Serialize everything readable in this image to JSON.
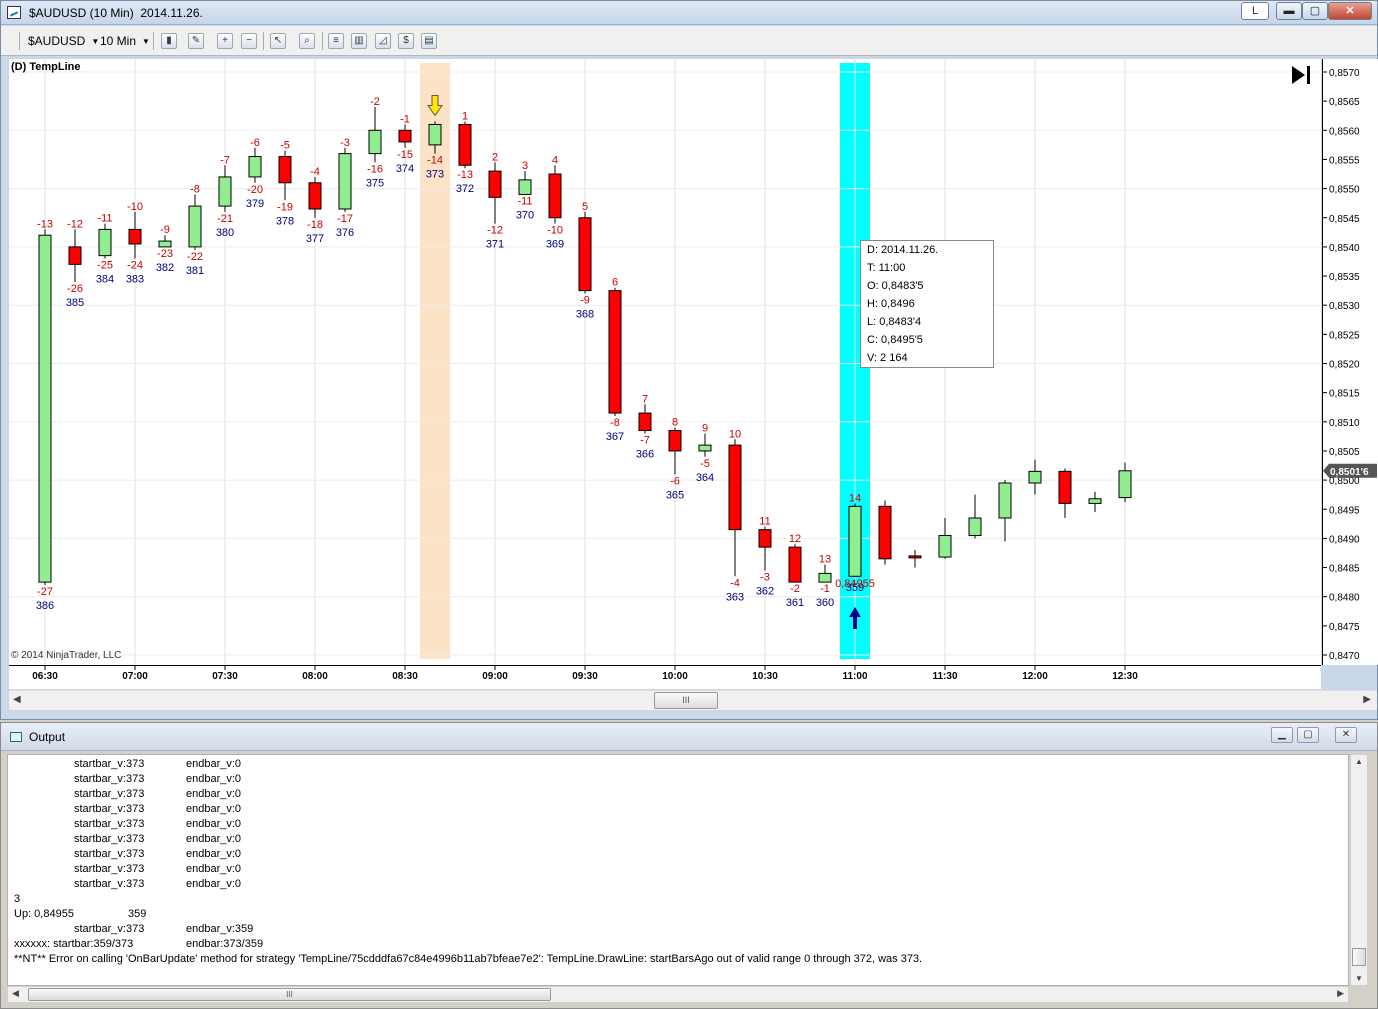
{
  "window": {
    "title": "$AUDUSD (10 Min)  2014.11.26.",
    "link_label": "L",
    "minimize_glyph": "▬",
    "maximize_glyph": "▢",
    "close_glyph": "✕"
  },
  "toolbar": {
    "instrument": "$AUDUSD",
    "interval": "10 Min",
    "icons": [
      "bar-type-icon",
      "pencil-draw-icon",
      "zoom-in-icon",
      "zoom-out-icon",
      "cursor-icon",
      "search-icon",
      "properties-icon",
      "indicators-icon",
      "strategies-icon",
      "dollar-icon",
      "layout-icon"
    ]
  },
  "chart": {
    "strategy_label": "(D) TempLine",
    "copyright": "© 2014 NinjaTrader, LLC",
    "current_price_label": "0,8501'6",
    "price_ticks": [
      "0,8570",
      "0,8565",
      "0,8560",
      "0,8555",
      "0,8550",
      "0,8545",
      "0,8540",
      "0,8535",
      "0,8530",
      "0,8525",
      "0,8520",
      "0,8515",
      "0,8510",
      "0,8505",
      "0,8500",
      "0,8495",
      "0,8490",
      "0,8485",
      "0,8480",
      "0,8475",
      "0,8470"
    ],
    "time_ticks": [
      "06:30",
      "07:00",
      "07:30",
      "08:00",
      "08:30",
      "09:00",
      "09:30",
      "10:00",
      "10:30",
      "11:00",
      "11:30",
      "12:00",
      "12:30"
    ],
    "scroll_thumb_label": "III",
    "signal_label": "0,84955",
    "colors": {
      "up": "#90ee90",
      "down": "#ff0000",
      "highlight_orange": "#fde3c6",
      "highlight_cyan": "#00ffff",
      "label_red": "#cc0000",
      "label_blue": "#000080"
    }
  },
  "chart_data": {
    "type": "candlestick",
    "ylim": [
      0.847,
      0.857
    ],
    "candles": [
      {
        "t": "06:30",
        "o": 0.84825,
        "h": 0.8543,
        "l": 0.8482,
        "c": 0.8542,
        "top": "-13",
        "bot": "-27",
        "idx": "386"
      },
      {
        "t": "06:40",
        "o": 0.854,
        "h": 0.8543,
        "l": 0.8534,
        "c": 0.8537,
        "top": "-12",
        "bot": "-26",
        "idx": "385"
      },
      {
        "t": "06:50",
        "o": 0.85385,
        "h": 0.8544,
        "l": 0.8538,
        "c": 0.8543,
        "top": "-11",
        "bot": "-25",
        "idx": "384"
      },
      {
        "t": "07:00",
        "o": 0.8543,
        "h": 0.8546,
        "l": 0.8538,
        "c": 0.85405,
        "top": "-10",
        "bot": "-24",
        "idx": "383"
      },
      {
        "t": "07:10",
        "o": 0.854,
        "h": 0.8542,
        "l": 0.854,
        "c": 0.8541,
        "top": "-9",
        "bot": "-23",
        "idx": "382"
      },
      {
        "t": "07:20",
        "o": 0.854,
        "h": 0.8549,
        "l": 0.85395,
        "c": 0.8547,
        "top": "-8",
        "bot": "-22",
        "idx": "381"
      },
      {
        "t": "07:30",
        "o": 0.8547,
        "h": 0.8554,
        "l": 0.8546,
        "c": 0.8552,
        "top": "-7",
        "bot": "-21",
        "idx": "380"
      },
      {
        "t": "07:40",
        "o": 0.8552,
        "h": 0.8557,
        "l": 0.8551,
        "c": 0.85555,
        "top": "-6",
        "bot": "-20",
        "idx": "379"
      },
      {
        "t": "07:50",
        "o": 0.85555,
        "h": 0.85565,
        "l": 0.8548,
        "c": 0.8551,
        "top": "-5",
        "bot": "-19",
        "idx": "378"
      },
      {
        "t": "08:00",
        "o": 0.8551,
        "h": 0.8552,
        "l": 0.8545,
        "c": 0.85465,
        "top": "-4",
        "bot": "-18",
        "idx": "377"
      },
      {
        "t": "08:10",
        "o": 0.85465,
        "h": 0.8557,
        "l": 0.8546,
        "c": 0.8556,
        "top": "-3",
        "bot": "-17",
        "idx": "376"
      },
      {
        "t": "08:20",
        "o": 0.8556,
        "h": 0.8564,
        "l": 0.85545,
        "c": 0.856,
        "top": "-2",
        "bot": "-16",
        "idx": "375"
      },
      {
        "t": "08:30",
        "o": 0.856,
        "h": 0.8561,
        "l": 0.8557,
        "c": 0.8558,
        "top": "-1",
        "bot": "-15",
        "idx": "374"
      },
      {
        "t": "08:40",
        "o": 0.85575,
        "h": 0.85615,
        "l": 0.8556,
        "c": 0.8561,
        "top": "",
        "bot": "-14",
        "idx": "373"
      },
      {
        "t": "08:50",
        "o": 0.8561,
        "h": 0.85615,
        "l": 0.85535,
        "c": 0.8554,
        "top": "1",
        "bot": "-13",
        "idx": "372"
      },
      {
        "t": "09:00",
        "o": 0.8553,
        "h": 0.85545,
        "l": 0.8544,
        "c": 0.85485,
        "top": "2",
        "bot": "-12",
        "idx": "371"
      },
      {
        "t": "09:10",
        "o": 0.8549,
        "h": 0.8553,
        "l": 0.8549,
        "c": 0.85515,
        "top": "3",
        "bot": "-11",
        "idx": "370"
      },
      {
        "t": "09:20",
        "o": 0.85525,
        "h": 0.8554,
        "l": 0.8544,
        "c": 0.8545,
        "top": "4",
        "bot": "-10",
        "idx": "369"
      },
      {
        "t": "09:30",
        "o": 0.8545,
        "h": 0.8546,
        "l": 0.8532,
        "c": 0.85325,
        "top": "5",
        "bot": "-9",
        "idx": "368"
      },
      {
        "t": "09:40",
        "o": 0.85325,
        "h": 0.8533,
        "l": 0.8511,
        "c": 0.85115,
        "top": "6",
        "bot": "-8",
        "idx": "367"
      },
      {
        "t": "09:50",
        "o": 0.85115,
        "h": 0.8513,
        "l": 0.8508,
        "c": 0.85085,
        "top": "7",
        "bot": "-7",
        "idx": "366"
      },
      {
        "t": "10:00",
        "o": 0.85085,
        "h": 0.8509,
        "l": 0.8501,
        "c": 0.8505,
        "top": "8",
        "bot": "-6",
        "idx": "365"
      },
      {
        "t": "10:10",
        "o": 0.8505,
        "h": 0.8508,
        "l": 0.8504,
        "c": 0.8506,
        "top": "9",
        "bot": "-5",
        "idx": "364"
      },
      {
        "t": "10:20",
        "o": 0.8506,
        "h": 0.8507,
        "l": 0.84835,
        "c": 0.84915,
        "top": "10",
        "bot": "-4",
        "idx": "363"
      },
      {
        "t": "10:30",
        "o": 0.84915,
        "h": 0.8492,
        "l": 0.84845,
        "c": 0.84885,
        "top": "11",
        "bot": "-3",
        "idx": "362"
      },
      {
        "t": "10:40",
        "o": 0.84885,
        "h": 0.8489,
        "l": 0.84825,
        "c": 0.84825,
        "top": "12",
        "bot": "-2",
        "idx": "361"
      },
      {
        "t": "10:50",
        "o": 0.84825,
        "h": 0.84855,
        "l": 0.84825,
        "c": 0.8484,
        "top": "13",
        "bot": "-1",
        "idx": "360"
      },
      {
        "t": "11:00",
        "o": 0.84835,
        "h": 0.8496,
        "l": 0.84834,
        "c": 0.84955,
        "top": "14",
        "bot": "",
        "idx": "359"
      },
      {
        "t": "11:10",
        "o": 0.84955,
        "h": 0.84965,
        "l": 0.84855,
        "c": 0.84865,
        "top": "",
        "bot": "",
        "idx": ""
      },
      {
        "t": "11:20",
        "o": 0.8487,
        "h": 0.8488,
        "l": 0.8485,
        "c": 0.84868,
        "top": "",
        "bot": "",
        "idx": ""
      },
      {
        "t": "11:30",
        "o": 0.84868,
        "h": 0.84935,
        "l": 0.84865,
        "c": 0.84905,
        "top": "",
        "bot": "",
        "idx": ""
      },
      {
        "t": "11:40",
        "o": 0.84905,
        "h": 0.84975,
        "l": 0.849,
        "c": 0.84935,
        "top": "",
        "bot": "",
        "idx": ""
      },
      {
        "t": "11:50",
        "o": 0.84935,
        "h": 0.85,
        "l": 0.84895,
        "c": 0.84995,
        "top": "",
        "bot": "",
        "idx": ""
      },
      {
        "t": "12:00",
        "o": 0.84995,
        "h": 0.85035,
        "l": 0.84975,
        "c": 0.85015,
        "top": "",
        "bot": "",
        "idx": ""
      },
      {
        "t": "12:10",
        "o": 0.85015,
        "h": 0.8502,
        "l": 0.84935,
        "c": 0.8496,
        "top": "",
        "bot": "",
        "idx": ""
      },
      {
        "t": "12:20",
        "o": 0.8496,
        "h": 0.8498,
        "l": 0.84945,
        "c": 0.84968,
        "top": "",
        "bot": "",
        "idx": ""
      },
      {
        "t": "12:30",
        "o": 0.8497,
        "h": 0.8503,
        "l": 0.84962,
        "c": 0.85016,
        "top": "",
        "bot": "",
        "idx": ""
      }
    ],
    "highlight_bars": [
      {
        "t": "08:40",
        "color": "orange"
      },
      {
        "t": "11:00",
        "color": "cyan"
      }
    ],
    "down_arrow_bar": "08:40",
    "up_arrow_bar": "11:00"
  },
  "databox": {
    "date": "D: 2014.11.26.",
    "time": "T: 11:00",
    "open": "O: 0,8483'5",
    "high": "H: 0,8496",
    "low": "L: 0,8483'4",
    "close": "C: 0,8495'5",
    "volume": "V: 2 164"
  },
  "output": {
    "title": "Output",
    "lines": [
      {
        "a": "startbar_v:373",
        "b": "endbar_v:0"
      },
      {
        "a": "startbar_v:373",
        "b": "endbar_v:0"
      },
      {
        "a": "startbar_v:373",
        "b": "endbar_v:0"
      },
      {
        "a": "startbar_v:373",
        "b": "endbar_v:0"
      },
      {
        "a": "startbar_v:373",
        "b": "endbar_v:0"
      },
      {
        "a": "startbar_v:373",
        "b": "endbar_v:0"
      },
      {
        "a": "startbar_v:373",
        "b": "endbar_v:0"
      },
      {
        "a": "startbar_v:373",
        "b": "endbar_v:0"
      },
      {
        "a": "startbar_v:373",
        "b": "endbar_v:0"
      }
    ],
    "line_3": "3",
    "up_line_a": "Up: 0,84955",
    "up_line_b": "359",
    "last_start": "startbar_v:373",
    "last_end": "endbar_v:359",
    "xx_line_a": "xxxxxx: startbar:359/373",
    "xx_line_b": "endbar:373/359",
    "error_line": "**NT** Error on calling 'OnBarUpdate' method for strategy 'TempLine/75cdddfa67c84e4996b11ab7bfeae7e2': TempLine.DrawLine: startBarsAgo out of valid range 0 through 372, was 373.",
    "scroll_thumb_label": "III"
  }
}
